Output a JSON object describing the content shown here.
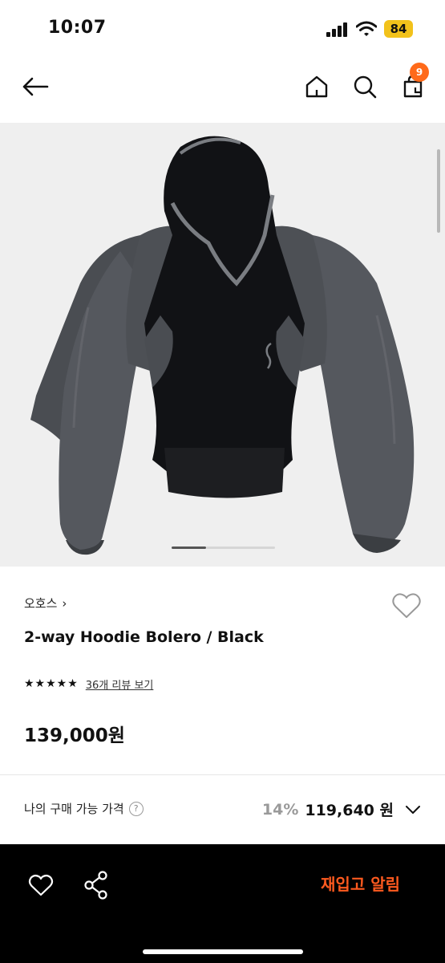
{
  "status_bar": {
    "time": "10:07",
    "battery": "84"
  },
  "nav": {
    "cart_count": "9",
    "icons": [
      "arrow-left-icon",
      "home-icon",
      "search-icon",
      "shopping-bag-icon"
    ]
  },
  "product": {
    "brand": "오호스",
    "brand_arrow": "›",
    "name": "2-way Hoodie Bolero / Black",
    "rating_stars": "★★★★★",
    "review_link": "36개 리뷰 보기",
    "price": "139,000원",
    "image_index": 1,
    "image_count": 3
  },
  "my_price": {
    "label": "나의 구매 가능 가격",
    "help": "?",
    "discount": "14%",
    "price": "119,640 원"
  },
  "action_bar": {
    "restock_label": "재입고 알림"
  },
  "colors": {
    "accent": "#ff5a1f",
    "badge": "#ff6a1a",
    "battery": "#f2c21b"
  }
}
